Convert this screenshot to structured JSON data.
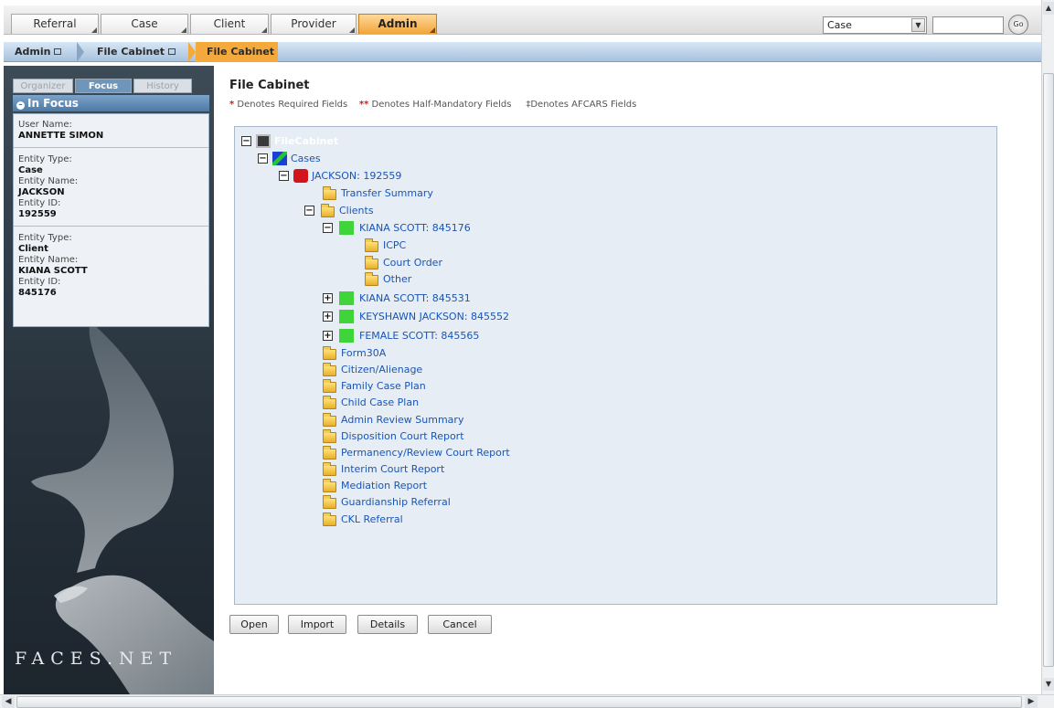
{
  "top_nav": {
    "tabs": [
      "Referral",
      "Case",
      "Client",
      "Provider",
      "Admin"
    ],
    "active_tab": "Admin",
    "search_type": "Case",
    "go_label": "Go"
  },
  "breadcrumb": {
    "items": [
      "Admin",
      "File Cabinet",
      "File Cabinet"
    ]
  },
  "left_panel": {
    "tabs": [
      "Organizer",
      "Focus",
      "History"
    ],
    "active_tab": "Focus",
    "header": "In Focus",
    "user_label": "User Name:",
    "user_name": "ANNETTE SIMON",
    "entities": [
      {
        "type_label": "Entity Type:",
        "type": "Case",
        "name_label": "Entity Name:",
        "name": "JACKSON",
        "id_label": "Entity ID:",
        "id": "192559"
      },
      {
        "type_label": "Entity Type:",
        "type": "Client",
        "name_label": "Entity Name:",
        "name": "KIANA SCOTT",
        "id_label": "Entity ID:",
        "id": "845176"
      }
    ],
    "logo": "FACES.NET"
  },
  "main": {
    "title": "File Cabinet",
    "legend": {
      "req_star": "*",
      "req_text": "Denotes Required Fields",
      "half_star": "**",
      "half_text": "Denotes Half-Mandatory Fields",
      "afcars_mark": "‡",
      "afcars_text": "Denotes AFCARS Fields"
    },
    "tree": {
      "root": "FileCabinet",
      "cases": "Cases",
      "case_node": "JACKSON: 192559",
      "transfer_summary": "Transfer Summary",
      "clients": "Clients",
      "client_1": "KIANA SCOTT: 845176",
      "client_1_folders": [
        "ICPC",
        "Court Order",
        "Other"
      ],
      "client_2": "KIANA SCOTT: 845531",
      "client_3": "KEYSHAWN JACKSON: 845552",
      "client_4": "FEMALE SCOTT: 845565",
      "case_folders": [
        "Form30A",
        "Citizen/Alienage",
        "Family Case Plan",
        "Child Case Plan",
        "Admin Review Summary",
        "Disposition Court Report",
        "Permanency/Review Court Report",
        "Interim Court Report",
        "Mediation Report",
        "Guardianship Referral",
        "CKL Referral"
      ]
    },
    "buttons": {
      "open": "Open",
      "import": "Import",
      "details": "Details",
      "cancel": "Cancel"
    }
  },
  "colors": {
    "accent_orange": "#f1a43a",
    "link_blue": "#1a55b5",
    "tree_bg": "#e6edf5",
    "panel_dark": "#25303a"
  }
}
